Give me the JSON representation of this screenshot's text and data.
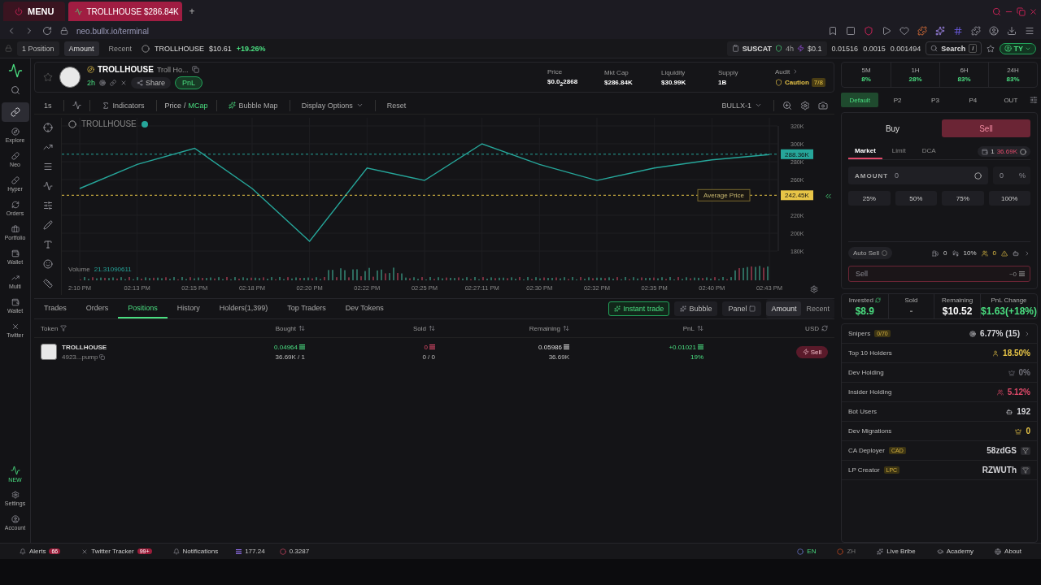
{
  "browser": {
    "menu": "MENU",
    "tab_title": "TROLLHOUSE $286.84K",
    "new_tab": "+",
    "url": "neo.bullx.io/terminal"
  },
  "top_bar": {
    "positions": "1 Position",
    "view_tabs": [
      {
        "label": "Amount",
        "selected": true
      },
      {
        "label": "Recent",
        "selected": false
      }
    ],
    "ticker": {
      "name": "TROLLHOUSE",
      "value": "$10.61",
      "change": "+19.26%"
    },
    "featured": {
      "name": "SUSCAT",
      "age": "4h",
      "amount": "$0.1"
    },
    "readings": [
      "0.01516",
      "0.0015",
      "0.001494"
    ],
    "search": {
      "label": "Search",
      "shortcut": "/"
    },
    "account": "TY"
  },
  "sidebar": {
    "items": [
      {
        "selected": false
      },
      {
        "selected": true
      },
      {
        "label": "Explore",
        "selected": false
      },
      {
        "label": "Neo",
        "selected": false
      },
      {
        "label": "Hyper",
        "selected": false
      },
      {
        "label": "Orders",
        "selected": false
      },
      {
        "label": "Portfolio",
        "selected": false
      },
      {
        "label": "Wallet",
        "selected": false
      },
      {
        "label": "Multi",
        "selected": false
      },
      {
        "label": "Wallet",
        "selected": false
      },
      {
        "label": "Twitter",
        "selected": false
      }
    ],
    "badge": "NEW",
    "footer": [
      "Settings",
      "Account"
    ]
  },
  "token": {
    "name": "TROLLHOUSE",
    "full_name": "Troll Ho...",
    "age": "2h",
    "share": "Share",
    "pnl": "PnL",
    "stats": [
      {
        "label": "Price",
        "value": "$0.0$_{2}$2868"
      },
      {
        "label": "Mkt Cap",
        "value": "$286.84K"
      },
      {
        "label": "Liquidity",
        "value": "$30.99K"
      },
      {
        "label": "Supply",
        "value": "1B"
      }
    ],
    "audit": {
      "label": "Audit",
      "status": "Caution",
      "score": "7/8"
    }
  },
  "chart_toolbar": {
    "interval": "1s",
    "indicators": "Indicators",
    "modes": [
      {
        "label": "Price",
        "selected": false
      },
      {
        "label": "MCap",
        "selected": true
      }
    ],
    "separator": "/",
    "bubble_map": "Bubble Map",
    "display_options": "Display Options",
    "reset": "Reset",
    "layout": "BULLX-1"
  },
  "chart": {
    "volume_label": "Volume",
    "volume_value": "21.31090611",
    "average_note": "Average Price",
    "chart_data": {
      "type": "line",
      "categories": [
        "2:10 PM",
        "02:13 PM",
        "02:15 PM",
        "02:18 PM",
        "02:20 PM",
        "02:22 PM",
        "02:25 PM",
        "02:27:11 PM",
        "02:30 PM",
        "02:32 PM",
        "02:35 PM",
        "02:40 PM",
        "02:43 PM"
      ],
      "series": [
        {
          "name": "TROLLHOUSE",
          "color": "#26a69a",
          "values": [
            250,
            277,
            295,
            250,
            191,
            273,
            259,
            300,
            277,
            259,
            273,
            282,
            288
          ]
        }
      ],
      "ylim": [
        180,
        320
      ],
      "grid": true,
      "yticks": [
        {
          "value": 180,
          "label": "180K"
        },
        {
          "value": 200,
          "label": "200K"
        },
        {
          "value": 220,
          "label": "220K"
        },
        {
          "value": 260,
          "label": "260K"
        },
        {
          "value": 280,
          "label": "280K"
        },
        {
          "value": 300,
          "label": "300K"
        },
        {
          "value": 320,
          "label": "320K"
        }
      ],
      "ref_lines": [
        {
          "axis": "y",
          "value": 288.36,
          "label": "288.36K",
          "color": "#26a69a"
        },
        {
          "axis": "y",
          "value": 242.45,
          "label": "242.45K",
          "color": "#e8c547"
        }
      ]
    }
  },
  "bottom_tabs": [
    {
      "label": "Trades",
      "selected": false
    },
    {
      "label": "Orders",
      "selected": false
    },
    {
      "label": "Positions",
      "selected": true
    },
    {
      "label": "History",
      "selected": false
    },
    {
      "label": "Holders(1,399)",
      "selected": false
    },
    {
      "label": "Top Traders",
      "selected": false
    },
    {
      "label": "Dev Tokens",
      "selected": false
    }
  ],
  "bottom_actions": {
    "instant_trade": "Instant trade",
    "bubble": "Bubble",
    "panel": "Panel",
    "view_tabs": [
      {
        "label": "Amount",
        "selected": true
      },
      {
        "label": "Recent",
        "selected": false
      }
    ]
  },
  "table": {
    "columns": [
      "Token",
      "Bought",
      "Sold",
      "Remaining",
      "PnL",
      "USD"
    ],
    "rows": [
      {
        "name": "TROLLHOUSE",
        "address": "4923...pump",
        "bought": "0.04964",
        "bought_sub": "36.69K / 1",
        "sold": "0",
        "sold_sub": "0 / 0",
        "remaining": "0.05986",
        "remaining_sub": "36.69K",
        "pnl": "+0.01021",
        "pnl_sub": "19%",
        "action": "Sell"
      }
    ]
  },
  "timeframes": [
    {
      "label": "5M",
      "value": "8%"
    },
    {
      "label": "1H",
      "value": "28%"
    },
    {
      "label": "6H",
      "value": "83%"
    },
    {
      "label": "24H",
      "value": "83%"
    }
  ],
  "presets": [
    {
      "label": "Default",
      "selected": true
    },
    {
      "label": "P2",
      "selected": false
    },
    {
      "label": "P3",
      "selected": false
    },
    {
      "label": "P4",
      "selected": false
    },
    {
      "label": "OUT",
      "selected": false
    }
  ],
  "trade": {
    "sides": [
      {
        "label": "Buy",
        "selected": false
      },
      {
        "label": "Sell",
        "selected": true
      }
    ],
    "order_types": [
      {
        "label": "Market",
        "selected": true
      },
      {
        "label": "Limit",
        "selected": false
      },
      {
        "label": "DCA",
        "selected": false
      }
    ],
    "wallet": {
      "count": "1",
      "balance": "36.69K"
    },
    "amount": {
      "label": "AMOUNT",
      "placeholder": "0"
    },
    "percent": {
      "placeholder": "0",
      "unit": "%"
    },
    "quick": [
      "25%",
      "50%",
      "75%",
      "100%"
    ],
    "auto_sell": {
      "label": "Auto Sell",
      "on": false
    },
    "settings": [
      "0",
      "10%",
      "0"
    ],
    "sell_field": {
      "placeholder": "Sell",
      "estimate": "~0"
    }
  },
  "summary": [
    {
      "label": "Invested",
      "value": "$8.9",
      "color": "#4ade80"
    },
    {
      "label": "Sold",
      "value": "-",
      "color": "#777777"
    },
    {
      "label": "Remaining",
      "value": "$10.52",
      "color": "#ffffff"
    },
    {
      "label": "PnL Change",
      "value": "$1.63(+18%)",
      "color": "#4ade80"
    }
  ],
  "info": [
    {
      "label": "Snipers",
      "tag": "0/70",
      "value": "6.77% (15)",
      "color": "#d4d4d8"
    },
    {
      "label": "Top 10 Holders",
      "value": "18.50%",
      "color": "#e8c547"
    },
    {
      "label": "Dev Holding",
      "value": "0%",
      "color": "#71717a"
    },
    {
      "label": "Insider Holding",
      "value": "5.12%",
      "color": "#e04a6a"
    },
    {
      "label": "Bot Users",
      "value": "192",
      "color": "#d4d4d8"
    },
    {
      "label": "Dev Migrations",
      "value": "0",
      "color": "#e8c547"
    },
    {
      "label": "CA Deployer",
      "tag": "CAD",
      "value": "58zdGS",
      "color": "#d4d4d8"
    },
    {
      "label": "LP Creator",
      "tag": "LPC",
      "value": "RZWUTh",
      "color": "#d4d4d8"
    }
  ],
  "status_bar": {
    "left": [
      {
        "label": "Alerts",
        "count": "66"
      },
      {
        "label": "Twitter Tracker",
        "count": "99+"
      },
      {
        "label": "Notifications"
      }
    ],
    "prices": [
      "177.24",
      "0.3287"
    ],
    "languages": [
      {
        "label": "EN",
        "selected": true
      },
      {
        "label": "ZH",
        "selected": false
      }
    ],
    "links": [
      "Live Bribe",
      "Academy",
      "About"
    ]
  }
}
